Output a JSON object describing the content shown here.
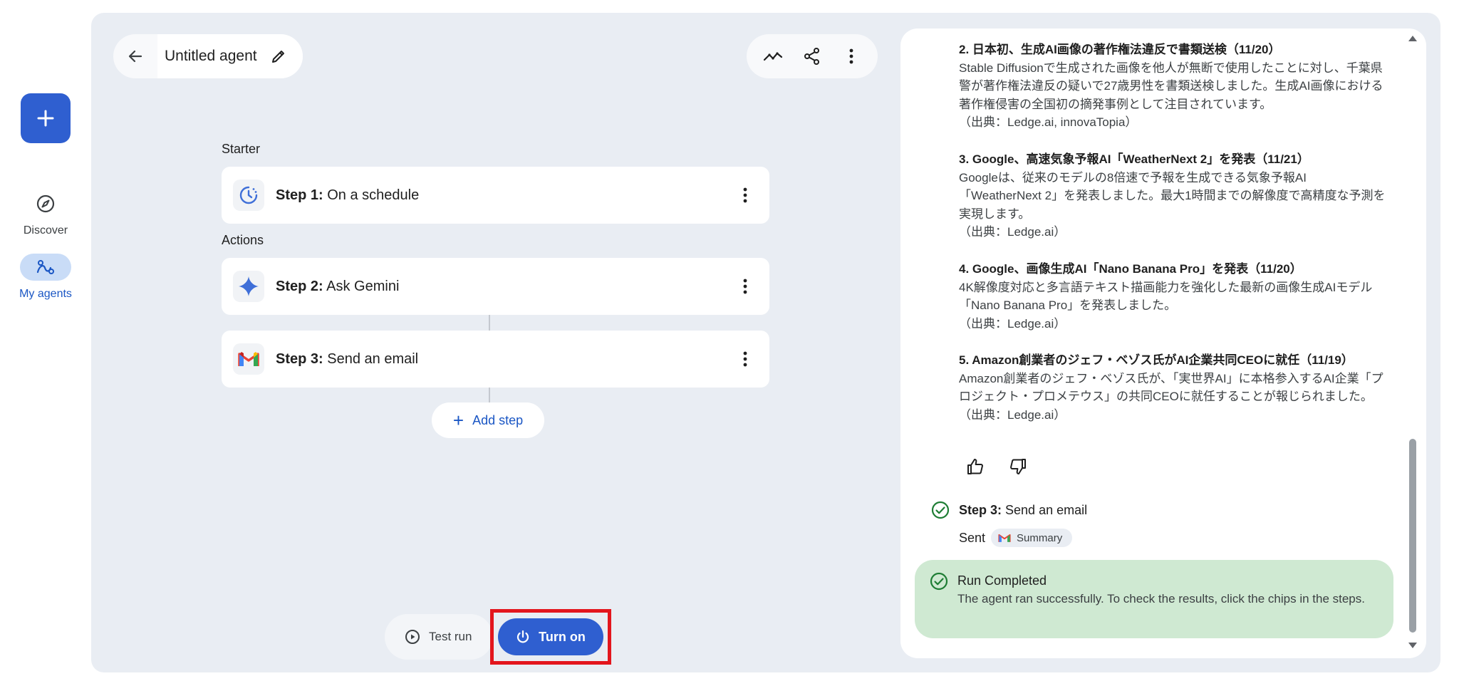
{
  "rail": {
    "discover_label": "Discover",
    "my_agents_label": "My agents"
  },
  "header": {
    "title": "Untitled agent"
  },
  "sections": {
    "starter_label": "Starter",
    "actions_label": "Actions"
  },
  "steps": [
    {
      "prefix": "Step 1:",
      "label": "On a schedule"
    },
    {
      "prefix": "Step 2:",
      "label": "Ask Gemini"
    },
    {
      "prefix": "Step 3:",
      "label": "Send an email"
    }
  ],
  "add_step_label": "Add step",
  "footer": {
    "test_run_label": "Test run",
    "turn_on_label": "Turn on"
  },
  "panel": {
    "news": [
      {
        "title": "2. 日本初、生成AI画像の著作権法違反で書類送検（11/20）",
        "body": "Stable Diffusionで生成された画像を他人が無断で使用したことに対し、千葉県警が著作権法違反の疑いで27歳男性を書類送検しました。生成AI画像における著作権侵害の全国初の摘発事例として注目されています。",
        "source": "（出典：Ledge.ai, innovaTopia）"
      },
      {
        "title": "3. Google、高速気象予報AI「WeatherNext 2」を発表（11/21）",
        "body": "Googleは、従来のモデルの8倍速で予報を生成できる気象予報AI「WeatherNext 2」を発表しました。最大1時間までの解像度で高精度な予測を実現します。",
        "source": "（出典：Ledge.ai）"
      },
      {
        "title": "4. Google、画像生成AI「Nano Banana Pro」を発表（11/20）",
        "body": "4K解像度対応と多言語テキスト描画能力を強化した最新の画像生成AIモデル「Nano Banana Pro」を発表しました。",
        "source": "（出典：Ledge.ai）"
      },
      {
        "title": "5. Amazon創業者のジェフ・ベゾス氏がAI企業共同CEOに就任（11/19）",
        "body": "Amazon創業者のジェフ・ベゾス氏が、「実世界AI」に本格参入するAI企業「プロジェクト・プロメテウス」の共同CEOに就任することが報じられました。",
        "source": "（出典：Ledge.ai）"
      }
    ],
    "step3": {
      "prefix": "Step 3:",
      "label": "Send an email",
      "sent_label": "Sent",
      "chip_label": "Summary"
    },
    "completed": {
      "title": "Run Completed",
      "description": "The agent ran successfully. To check the results, click the chips in the steps."
    }
  },
  "colors": {
    "accent": "#2f5fd0",
    "highlight_border": "#e3161d",
    "success_bg": "#cfe9d2",
    "success_icon": "#1e7d34"
  }
}
